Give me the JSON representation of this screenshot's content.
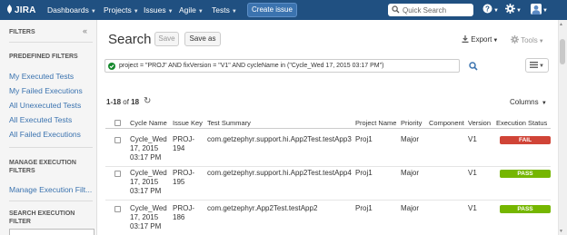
{
  "nav": {
    "logo": "JIRA",
    "items": [
      "Dashboards",
      "Projects",
      "Issues",
      "Agile",
      "Tests"
    ],
    "create_issue": "Create issue",
    "quick_search_placeholder": "Quick Search",
    "colors": {
      "bar": "#205081",
      "create": "#3b73af"
    }
  },
  "sidebar": {
    "filters_title": "FILTERS",
    "collapse_icon": "double-chevron-left-icon",
    "predefined_heading": "PREDEFINED FILTERS",
    "predefined": [
      "My Executed Tests",
      "My Failed Executions",
      "All Unexecuted Tests",
      "All Executed Tests",
      "All Failed Executions"
    ],
    "manage_heading": "MANAGE EXECUTION FILTERS",
    "manage_link": "Manage Execution Filt...",
    "search_heading": "SEARCH EXECUTION FILTER"
  },
  "main": {
    "title": "Search",
    "save_label": "Save",
    "save_as_label": "Save as",
    "export_label": "Export",
    "tools_label": "Tools",
    "query": "project = \"PROJ\" AND fixVersion = \"V1\" AND cycleName in (\"Cycle_Wed 17, 2015 03:17 PM\")",
    "results_range": "1-18",
    "results_of": "of",
    "results_total": "18",
    "columns_label": "Columns"
  },
  "table": {
    "headers": [
      "Cycle Name",
      "Issue Key",
      "Test Summary",
      "Project Name",
      "Priority",
      "Component",
      "Version",
      "Execution Status"
    ],
    "rows": [
      {
        "cycle": "Cycle_Wed 17, 2015 03:17 PM",
        "key": "PROJ-194",
        "summary": "com.getzephyr.support.hi.App2Test.testApp3",
        "project": "Proj1",
        "priority": "Major",
        "component": "",
        "version": "V1",
        "status": "FAIL",
        "status_color": "#d04437"
      },
      {
        "cycle": "Cycle_Wed 17, 2015 03:17 PM",
        "key": "PROJ-195",
        "summary": "com.getzephyr.support.hi.App2Test.testApp4",
        "project": "Proj1",
        "priority": "Major",
        "component": "",
        "version": "V1",
        "status": "PASS",
        "status_color": "#75b600"
      },
      {
        "cycle": "Cycle_Wed 17, 2015 03:17 PM",
        "key": "PROJ-186",
        "summary": "com.getzephyr.App2Test.testApp2",
        "project": "Proj1",
        "priority": "Major",
        "component": "",
        "version": "V1",
        "status": "PASS",
        "status_color": "#75b600"
      }
    ]
  }
}
